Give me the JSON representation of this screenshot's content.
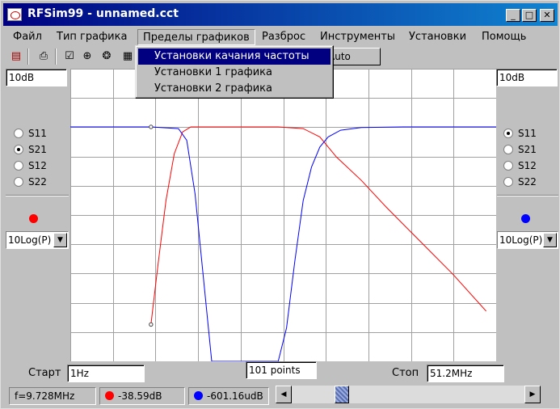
{
  "window": {
    "title": "RFSim99 - unnamed.cct"
  },
  "menu": {
    "items": [
      "Файл",
      "Тип графика",
      "Пределы графиков",
      "Разброс",
      "Инструменты",
      "Установки",
      "Помощь"
    ],
    "active_index": 2
  },
  "toolbar": {
    "icons": [
      "open-icon",
      "print-icon",
      "graph-icon",
      "smith-icon",
      "polar-icon",
      "table-icon"
    ],
    "auto_match_label": "Auto Match"
  },
  "dropdown": {
    "items": [
      "Установки качания частоты",
      "Установки 1 графика",
      "Установки 2 графика"
    ],
    "highlighted_index": 0
  },
  "left_panel": {
    "scale_value": "10dB",
    "params": [
      "S11",
      "S21",
      "S12",
      "S22"
    ],
    "selected": "S21",
    "trace_color": "#ff0000",
    "mode": "10Log(P)"
  },
  "right_panel": {
    "scale_value": "10dB",
    "params": [
      "S11",
      "S21",
      "S12",
      "S22"
    ],
    "selected": "S11",
    "trace_color": "#0000ff",
    "mode": "10Log(P)"
  },
  "sweep": {
    "start_label": "Старт",
    "start_value": "1Hz",
    "points_value": "101 points",
    "stop_label": "Стоп",
    "stop_value": "51.2MHz"
  },
  "status": {
    "frequency": "f=9.728MHz",
    "trace1_value": "-38.59dB",
    "trace2_value": "-601.16udB"
  },
  "chart_data": {
    "type": "line",
    "grid": true,
    "x_range": [
      0,
      51.2
    ],
    "x_unit": "MHz",
    "y_divisions": 7,
    "x_divisions": 10,
    "series": [
      {
        "color": "#ff0000",
        "points": [
          [
            9.7,
            -59
          ],
          [
            10.5,
            -42
          ],
          [
            11.5,
            -22
          ],
          [
            12.5,
            -8
          ],
          [
            13.5,
            -1.5
          ],
          [
            14.5,
            0
          ],
          [
            20,
            0
          ],
          [
            25,
            0
          ],
          [
            28,
            -0.5
          ],
          [
            30,
            -3
          ],
          [
            32,
            -9
          ],
          [
            35,
            -16
          ],
          [
            38,
            -24
          ],
          [
            42,
            -34
          ],
          [
            46,
            -44
          ],
          [
            50,
            -55
          ]
        ]
      },
      {
        "color": "#0000ff",
        "points": [
          [
            0,
            0
          ],
          [
            9.7,
            0
          ],
          [
            13,
            -0.5
          ],
          [
            14,
            -4
          ],
          [
            15,
            -20
          ],
          [
            16,
            -45
          ],
          [
            17,
            -70
          ],
          [
            25,
            -70
          ],
          [
            26,
            -60
          ],
          [
            27,
            -40
          ],
          [
            28,
            -22
          ],
          [
            29,
            -12
          ],
          [
            30,
            -6
          ],
          [
            31,
            -3
          ],
          [
            32.5,
            -1
          ],
          [
            35,
            -0.2
          ],
          [
            40,
            0
          ],
          [
            51.2,
            0
          ]
        ]
      }
    ],
    "y_range": [
      -70,
      0
    ],
    "markers": [
      [
        9.7,
        0
      ],
      [
        9.7,
        -59
      ]
    ]
  }
}
